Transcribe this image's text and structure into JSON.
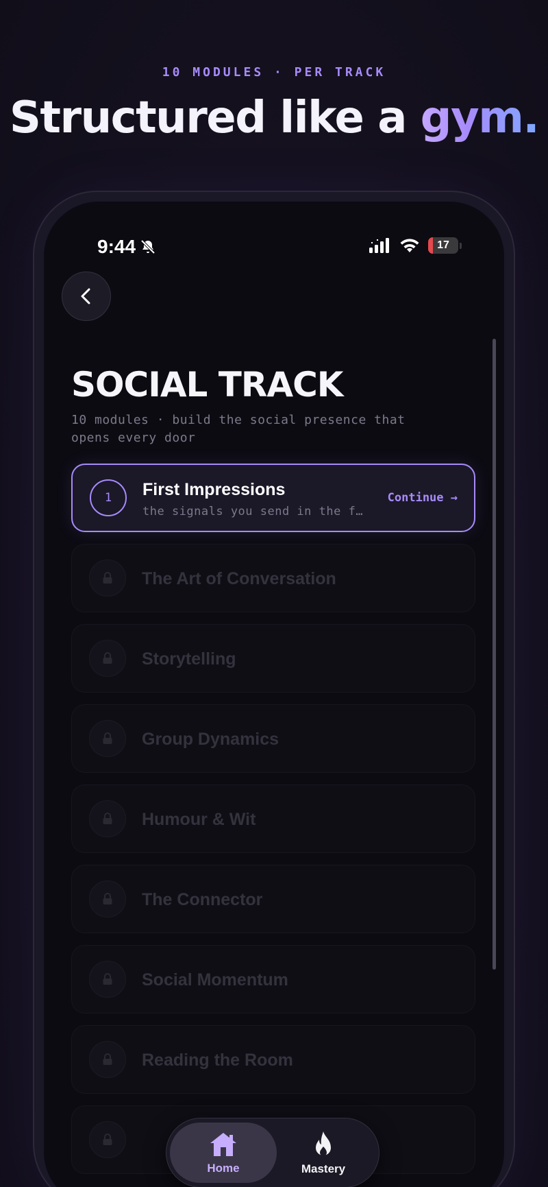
{
  "header": {
    "kicker": "10 MODULES · PER TRACK",
    "headline_main": "Structured like a ",
    "headline_accent": "gym."
  },
  "status_bar": {
    "time": "9:44",
    "battery_level": "17",
    "icons": [
      "bell-slash-icon",
      "cellular-signal-icon",
      "wifi-icon",
      "battery-icon"
    ]
  },
  "nav": {
    "back_icon": "chevron-left-icon"
  },
  "track": {
    "title": "SOCIAL TRACK",
    "subtitle": "10 modules · build the social presence that opens every door"
  },
  "modules": [
    {
      "number": "1",
      "title": "First Impressions",
      "description": "the signals you send in the first seconds",
      "cta": "Continue →",
      "state": "active"
    },
    {
      "title": "The Art of Conversation",
      "state": "locked"
    },
    {
      "title": "Storytelling",
      "state": "locked"
    },
    {
      "title": "Group Dynamics",
      "state": "locked"
    },
    {
      "title": "Humour & Wit",
      "state": "locked"
    },
    {
      "title": "The Connector",
      "state": "locked"
    },
    {
      "title": "Social Momentum",
      "state": "locked"
    },
    {
      "title": "Reading the Room",
      "state": "locked"
    },
    {
      "title": "",
      "state": "locked"
    }
  ],
  "tab_bar": {
    "tabs": [
      {
        "label": "Home",
        "icon": "home-icon",
        "selected": true
      },
      {
        "label": "Mastery",
        "icon": "flame-icon",
        "selected": false
      }
    ]
  },
  "colors": {
    "accent": "#a78bfa",
    "background": "#15111f",
    "screen": "#0c0b12",
    "battery_low": "#e5484d"
  }
}
